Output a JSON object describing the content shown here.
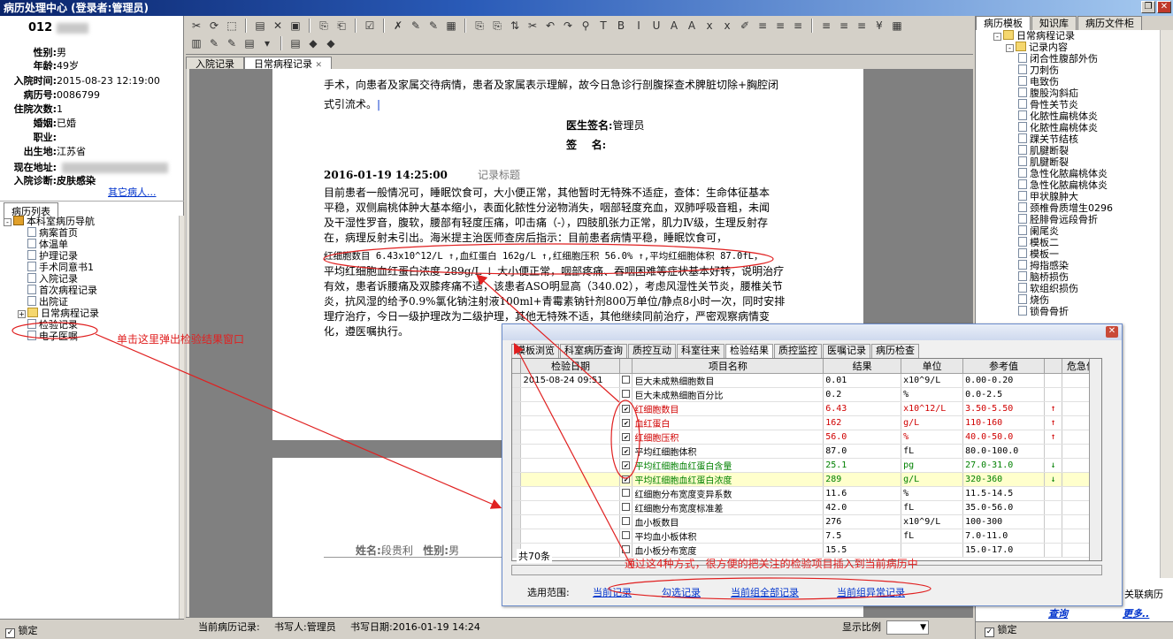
{
  "window": {
    "title": "病历处理中心 (登录者:管理员)",
    "btn_restore": "❐",
    "btn_close": "✕"
  },
  "patient": {
    "id": "012",
    "rows": [
      {
        "key": "性别:",
        "val": "男"
      },
      {
        "key": "年龄:",
        "val": "49岁"
      },
      {
        "key": "入院时间:",
        "val": "2015-08-23 12:19:00"
      },
      {
        "key": "病历号:",
        "val": "0086799"
      },
      {
        "key": "住院次数:",
        "val": "1"
      },
      {
        "key": "婚姻:",
        "val": "已婚"
      },
      {
        "key": "职业:",
        "val": ""
      },
      {
        "key": "出生地:",
        "val": "江苏省"
      },
      {
        "key": "现在地址:",
        "val": ""
      },
      {
        "key": "入院诊断:",
        "val": "皮肤感染"
      }
    ],
    "other_patients": "其它病人..."
  },
  "left_tab": "病历列表",
  "left_tree": [
    {
      "label": "本科室病历导航",
      "level": 0,
      "type": "root",
      "expander": "-"
    },
    {
      "label": "病案首页",
      "level": 1,
      "type": "doc"
    },
    {
      "label": "体温单",
      "level": 1,
      "type": "doc"
    },
    {
      "label": "护理记录",
      "level": 1,
      "type": "doc"
    },
    {
      "label": "手术同意书1",
      "level": 1,
      "type": "doc"
    },
    {
      "label": "入院记录",
      "level": 1,
      "type": "doc"
    },
    {
      "label": "首次病程记录",
      "level": 1,
      "type": "doc"
    },
    {
      "label": "出院证",
      "level": 1,
      "type": "doc"
    },
    {
      "label": "日常病程记录",
      "level": 1,
      "type": "folder",
      "expander": "+"
    },
    {
      "label": "检验记录",
      "level": 1,
      "type": "doc"
    },
    {
      "label": "电子医嘱",
      "level": 1,
      "type": "doc"
    }
  ],
  "left_lock": "锁定",
  "doc_tabs": [
    "入院记录",
    "日常病程记录"
  ],
  "doc_tab_close": "✕",
  "document": {
    "p1": "手术，向患者及家属交待病情，患者及家属表示理解，故今日急诊行剖腹探查术脾脏切除+胸腔闭",
    "p2": "式引流术。",
    "sign_label": "医生签名:",
    "sign_value": "管理员",
    "sign2_label": "签    名:",
    "record_time": "2016-01-19 14:25:00",
    "record_title": "记录标题",
    "body": [
      "目前患者一般情况可，睡眠饮食可，大小便正常，其他暂时无特殊不适症，查体：生命体征基本",
      "平稳，双侧扁桃体肿大基本缩小，表面化脓性分泌物消失，咽部轻度充血，双肺呼吸音粗，未闻",
      "及干湿性罗音，腹软，腰部有轻度压痛，叩击痛（-），四肢肌张力正常，肌力Ⅳ级，生理反射存",
      "在，病理反射未引出。海米提主治医师查房后指示：目前患者病情平稳，睡眠饮食可，"
    ],
    "lab_line1": "红细胞数目 6.43x10^12/L ↑,血红蛋白 162g/L ↑,红细胞压积 56.0% ↑,平均红细胞体积 87.0fL，",
    "lab_line2": "平均红细胞血红蛋白浓度 289g/L ↓ 大小便正常，咽部疼痛、吞咽困难等症状基本好转，说明治疗",
    "body2": [
      "有效，患者诉腰痛及双膝疼痛不适，该患者ASO明显高（340.02），考虑风湿性关节炎，腰椎关节",
      "炎，抗风湿的给予0.9%氯化钠注射液100ml+青霉素钠针剂800万单位/静点8小时一次，同时安排",
      "理疗治疗，今日一级护理改为二级护理，其他无特殊不适，其他继续同前治疗，严密观察病情变",
      "化，遵医嘱执行。"
    ],
    "page2_name_label": "姓名:",
    "page2_name": "段贵利",
    "page2_sex_label": "性别:",
    "page2_sex": "男"
  },
  "status": {
    "current_record": "当前病历记录:",
    "writer": "书写人:管理员",
    "write_date": "书写日期:2016-01-19 14:24",
    "zoom_label": "显示比例"
  },
  "right_tabs": [
    "病历模板",
    "知识库",
    "病历文件柜"
  ],
  "right_tree": [
    {
      "label": "日常病程记录",
      "level": 0,
      "expander": "-"
    },
    {
      "label": "记录内容",
      "level": 1,
      "expander": "-"
    },
    {
      "label": "闭合性腹部外伤",
      "level": 2
    },
    {
      "label": "刀刺伤",
      "level": 2
    },
    {
      "label": "电致伤",
      "level": 2
    },
    {
      "label": "腹股沟斜疝",
      "level": 2
    },
    {
      "label": "骨性关节炎",
      "level": 2
    },
    {
      "label": "化脓性扁桃体炎",
      "level": 2
    },
    {
      "label": "化脓性扁桃体炎",
      "level": 2
    },
    {
      "label": "踝关节结核",
      "level": 2
    },
    {
      "label": "肌腱断裂",
      "level": 2
    },
    {
      "label": "肌腱断裂",
      "level": 2
    },
    {
      "label": "急性化脓扁桃体炎",
      "level": 2
    },
    {
      "label": "急性化脓扁桃体炎",
      "level": 2
    },
    {
      "label": "甲状腺肿大",
      "level": 2
    },
    {
      "label": "颈椎骨质增生0296",
      "level": 2
    },
    {
      "label": "胫腓骨远段骨折",
      "level": 2
    },
    {
      "label": "阑尾炎",
      "level": 2
    },
    {
      "label": "模板二",
      "level": 2
    },
    {
      "label": "模板一",
      "level": 2
    },
    {
      "label": "拇指感染",
      "level": 2
    },
    {
      "label": "脑桥损伤",
      "level": 2
    },
    {
      "label": "软组织损伤",
      "level": 2
    },
    {
      "label": "烧伤",
      "level": 2
    },
    {
      "label": "锁骨骨折",
      "level": 2
    }
  ],
  "right_side_text": "关联病历",
  "right_links": {
    "query": "查询",
    "more": "更多.."
  },
  "right_lock": "锁定",
  "dialog": {
    "tabs": [
      "模板浏览",
      "科室病历查询",
      "质控互动",
      "科室往来",
      "检验结果",
      "质控监控",
      "医嘱记录",
      "病历检查"
    ],
    "active_tab": "检验结果",
    "columns": [
      "检验日期",
      "",
      "项目名称",
      "结果",
      "单位",
      "参考值",
      "",
      "危急值"
    ],
    "rows": [
      {
        "date": "2015-08-24 09:51",
        "checked": false,
        "name": "巨大未成熟细胞数目",
        "result": "0.01",
        "unit": "x10^9/L",
        "ref": "0.00-0.20",
        "flag": "",
        "style": ""
      },
      {
        "date": "",
        "checked": false,
        "name": "巨大未成熟细胞百分比",
        "result": "0.2",
        "unit": "%",
        "ref": "0.0-2.5",
        "flag": "",
        "style": ""
      },
      {
        "date": "",
        "checked": true,
        "name": "红细胞数目",
        "result": "6.43",
        "unit": "x10^12/L",
        "ref": "3.50-5.50",
        "flag": "↑",
        "style": "flagged"
      },
      {
        "date": "",
        "checked": true,
        "name": "血红蛋白",
        "result": "162",
        "unit": "g/L",
        "ref": "110-160",
        "flag": "↑",
        "style": "flagged"
      },
      {
        "date": "",
        "checked": true,
        "name": "红细胞压积",
        "result": "56.0",
        "unit": "%",
        "ref": "40.0-50.0",
        "flag": "↑",
        "style": "flagged"
      },
      {
        "date": "",
        "checked": true,
        "name": "平均红细胞体积",
        "result": "87.0",
        "unit": "fL",
        "ref": "80.0-100.0",
        "flag": "",
        "style": ""
      },
      {
        "date": "",
        "checked": true,
        "name": "平均红细胞血红蛋白含量",
        "result": "25.1",
        "unit": "pg",
        "ref": "27.0-31.0",
        "flag": "↓",
        "style": "lowflag"
      },
      {
        "date": "",
        "checked": true,
        "name": "平均红细胞血红蛋白浓度",
        "result": "289",
        "unit": "g/L",
        "ref": "320-360",
        "flag": "↓",
        "style": "lowflag selected"
      },
      {
        "date": "",
        "checked": false,
        "name": "红细胞分布宽度变异系数",
        "result": "11.6",
        "unit": "%",
        "ref": "11.5-14.5",
        "flag": "",
        "style": ""
      },
      {
        "date": "",
        "checked": false,
        "name": "红细胞分布宽度标准差",
        "result": "42.0",
        "unit": "fL",
        "ref": "35.0-56.0",
        "flag": "",
        "style": ""
      },
      {
        "date": "",
        "checked": false,
        "name": "血小板数目",
        "result": "276",
        "unit": "x10^9/L",
        "ref": "100-300",
        "flag": "",
        "style": ""
      },
      {
        "date": "",
        "checked": false,
        "name": "平均血小板体积",
        "result": "7.5",
        "unit": "fL",
        "ref": "7.0-11.0",
        "flag": "",
        "style": ""
      },
      {
        "date": "",
        "checked": false,
        "name": "血小板分布宽度",
        "result": "15.5",
        "unit": "",
        "ref": "15.0-17.0",
        "flag": "",
        "style": ""
      }
    ],
    "total": "共70条",
    "scope_label": "选用范围:",
    "scope_links": [
      "当前记录",
      "勾选记录",
      "当前组全部记录",
      "当前组异常记录"
    ]
  },
  "annotations": {
    "left": "单击这里弹出检验结果窗口",
    "bottom": "通过这4种方式，很方便的把关注的检验项目插入到当前病历中"
  },
  "colors": {
    "annotation": "#e02020",
    "flag_high": "#d00000",
    "flag_low": "#008000",
    "link": "#0033cc"
  }
}
